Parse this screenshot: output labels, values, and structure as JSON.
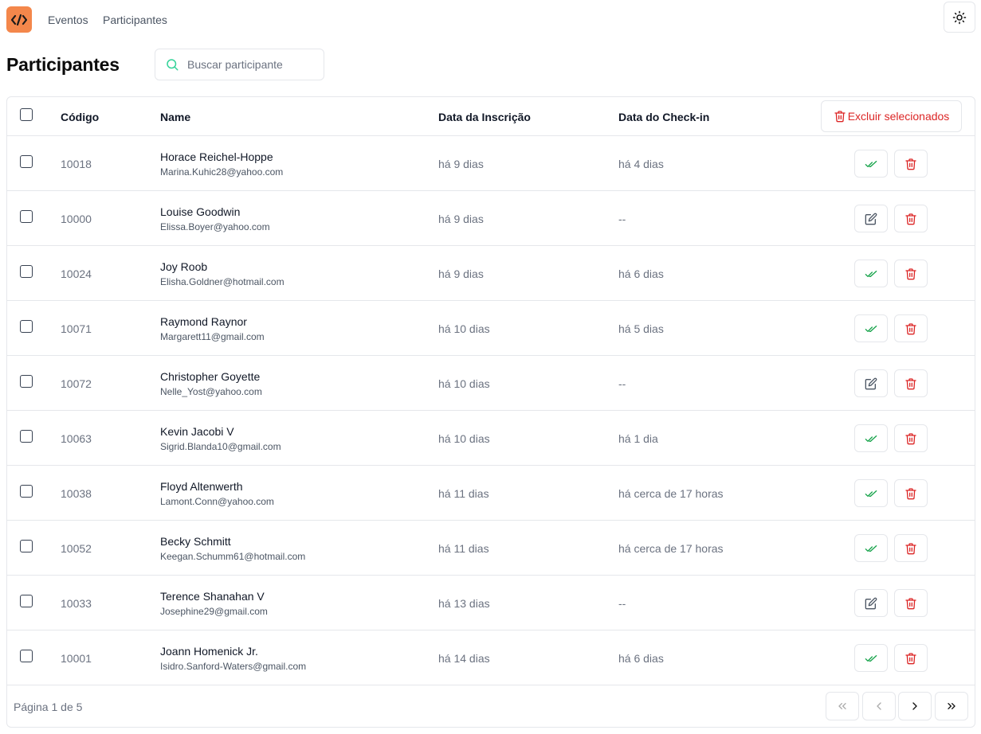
{
  "app": {
    "logo_icon": "code-icon",
    "accent_color": "#f4874b"
  },
  "nav": {
    "items": [
      "Eventos",
      "Participantes"
    ]
  },
  "theme_toggle_icon": "sun-icon",
  "page": {
    "title": "Participantes"
  },
  "search": {
    "placeholder": "Buscar participante",
    "value": ""
  },
  "table": {
    "headers": {
      "code": "Código",
      "name": "Name",
      "inscricao": "Data da Inscrição",
      "checkin": "Data do Check-in"
    },
    "delete_selected_label": "Excluir selecionados",
    "rows": [
      {
        "code": "10018",
        "name": "Horace Reichel-Hoppe",
        "email": "Marina.Kuhic28@yahoo.com",
        "inscricao": "há 9 dias",
        "checkin": "há 4 dias",
        "action": "check"
      },
      {
        "code": "10000",
        "name": "Louise Goodwin",
        "email": "Elissa.Boyer@yahoo.com",
        "inscricao": "há 9 dias",
        "checkin": "--",
        "action": "edit"
      },
      {
        "code": "10024",
        "name": "Joy Roob",
        "email": "Elisha.Goldner@hotmail.com",
        "inscricao": "há 9 dias",
        "checkin": "há 6 dias",
        "action": "check"
      },
      {
        "code": "10071",
        "name": "Raymond Raynor",
        "email": "Margarett11@gmail.com",
        "inscricao": "há 10 dias",
        "checkin": "há 5 dias",
        "action": "check"
      },
      {
        "code": "10072",
        "name": "Christopher Goyette",
        "email": "Nelle_Yost@yahoo.com",
        "inscricao": "há 10 dias",
        "checkin": "--",
        "action": "edit"
      },
      {
        "code": "10063",
        "name": "Kevin Jacobi V",
        "email": "Sigrid.Blanda10@gmail.com",
        "inscricao": "há 10 dias",
        "checkin": "há 1 dia",
        "action": "check"
      },
      {
        "code": "10038",
        "name": "Floyd Altenwerth",
        "email": "Lamont.Conn@yahoo.com",
        "inscricao": "há 11 dias",
        "checkin": "há cerca de 17 horas",
        "action": "check"
      },
      {
        "code": "10052",
        "name": "Becky Schmitt",
        "email": "Keegan.Schumm61@hotmail.com",
        "inscricao": "há 11 dias",
        "checkin": "há cerca de 17 horas",
        "action": "check"
      },
      {
        "code": "10033",
        "name": "Terence Shanahan V",
        "email": "Josephine29@gmail.com",
        "inscricao": "há 13 dias",
        "checkin": "--",
        "action": "edit"
      },
      {
        "code": "10001",
        "name": "Joann Homenick Jr.",
        "email": "Isidro.Sanford-Waters@gmail.com",
        "inscricao": "há 14 dias",
        "checkin": "há 6 dias",
        "action": "check"
      }
    ]
  },
  "pagination": {
    "label": "Página 1 de 5"
  },
  "colors": {
    "danger": "#dc2626",
    "success": "#16a34a",
    "border": "#e5e7eb"
  }
}
